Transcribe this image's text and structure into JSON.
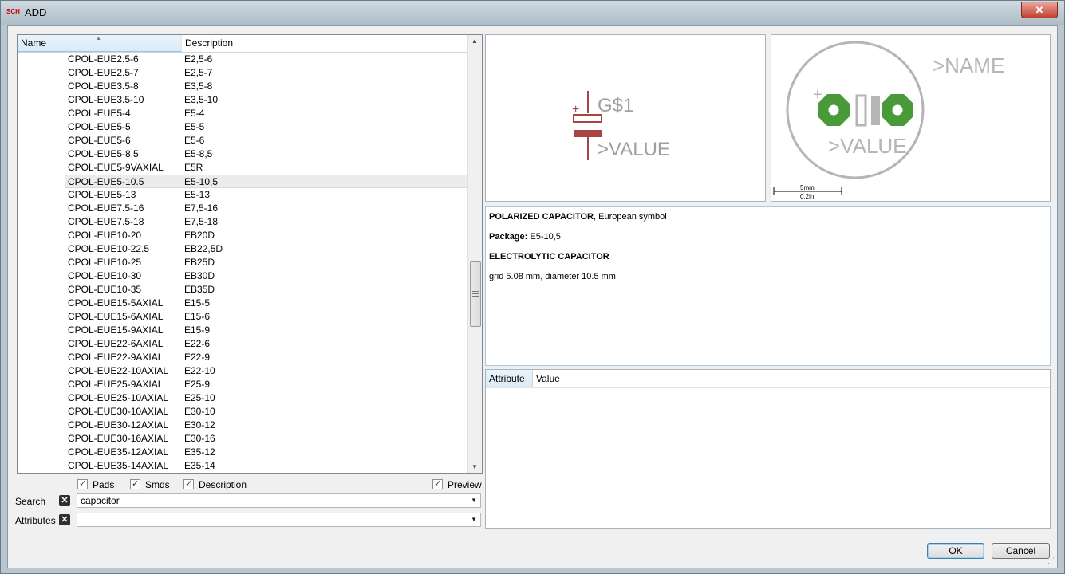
{
  "window": {
    "title": "ADD",
    "icon_text": "SCH",
    "close": "✕"
  },
  "list": {
    "columns": {
      "name": "Name",
      "description": "Description"
    },
    "rows": [
      {
        "name": "CPOL-EUE2.5-6",
        "desc": "E2,5-6"
      },
      {
        "name": "CPOL-EUE2.5-7",
        "desc": "E2,5-7"
      },
      {
        "name": "CPOL-EUE3.5-8",
        "desc": "E3,5-8"
      },
      {
        "name": "CPOL-EUE3.5-10",
        "desc": "E3,5-10"
      },
      {
        "name": "CPOL-EUE5-4",
        "desc": "E5-4"
      },
      {
        "name": "CPOL-EUE5-5",
        "desc": "E5-5"
      },
      {
        "name": "CPOL-EUE5-6",
        "desc": "E5-6"
      },
      {
        "name": "CPOL-EUE5-8.5",
        "desc": "E5-8,5"
      },
      {
        "name": "CPOL-EUE5-9VAXIAL",
        "desc": "E5R"
      },
      {
        "name": "CPOL-EUE5-10.5",
        "desc": "E5-10,5"
      },
      {
        "name": "CPOL-EUE5-13",
        "desc": "E5-13"
      },
      {
        "name": "CPOL-EUE7.5-16",
        "desc": "E7,5-16"
      },
      {
        "name": "CPOL-EUE7.5-18",
        "desc": "E7,5-18"
      },
      {
        "name": "CPOL-EUE10-20",
        "desc": "EB20D"
      },
      {
        "name": "CPOL-EUE10-22.5",
        "desc": "EB22,5D"
      },
      {
        "name": "CPOL-EUE10-25",
        "desc": "EB25D"
      },
      {
        "name": "CPOL-EUE10-30",
        "desc": "EB30D"
      },
      {
        "name": "CPOL-EUE10-35",
        "desc": "EB35D"
      },
      {
        "name": "CPOL-EUE15-5AXIAL",
        "desc": "E15-5"
      },
      {
        "name": "CPOL-EUE15-6AXIAL",
        "desc": "E15-6"
      },
      {
        "name": "CPOL-EUE15-9AXIAL",
        "desc": "E15-9"
      },
      {
        "name": "CPOL-EUE22-6AXIAL",
        "desc": "E22-6"
      },
      {
        "name": "CPOL-EUE22-9AXIAL",
        "desc": "E22-9"
      },
      {
        "name": "CPOL-EUE22-10AXIAL",
        "desc": "E22-10"
      },
      {
        "name": "CPOL-EUE25-9AXIAL",
        "desc": "E25-9"
      },
      {
        "name": "CPOL-EUE25-10AXIAL",
        "desc": "E25-10"
      },
      {
        "name": "CPOL-EUE30-10AXIAL",
        "desc": "E30-10"
      },
      {
        "name": "CPOL-EUE30-12AXIAL",
        "desc": "E30-12"
      },
      {
        "name": "CPOL-EUE30-16AXIAL",
        "desc": "E30-16"
      },
      {
        "name": "CPOL-EUE35-12AXIAL",
        "desc": "E35-12"
      },
      {
        "name": "CPOL-EUE35-14AXIAL",
        "desc": "E35-14"
      }
    ]
  },
  "options": {
    "pads": "Pads",
    "smds": "Smds",
    "description": "Description",
    "preview": "Preview"
  },
  "search": {
    "label": "Search",
    "value": "capacitor"
  },
  "attributes": {
    "label": "Attributes",
    "value": ""
  },
  "symbol_preview": {
    "name": "G$1",
    "value": ">VALUE",
    "plus": "+"
  },
  "package_preview": {
    "name": ">NAME",
    "value": ">VALUE",
    "plus": "+",
    "scale_mm": "5mm",
    "scale_in": "0.2in"
  },
  "description": {
    "title": "POLARIZED CAPACITOR",
    "title_rest": ", European symbol",
    "package_label": "Package:",
    "package_value": " E5-10,5",
    "subtitle": "ELECTROLYTIC CAPACITOR",
    "detail": "grid 5.08 mm, diameter 10.5 mm"
  },
  "attr_table": {
    "col_attribute": "Attribute",
    "col_value": "Value"
  },
  "buttons": {
    "ok": "OK",
    "cancel": "Cancel"
  },
  "colors": {
    "symbol": "#a84444",
    "symbol_text": "#a0a0a0",
    "pad": "#4a9a3a",
    "outline": "#b5b5b5"
  }
}
